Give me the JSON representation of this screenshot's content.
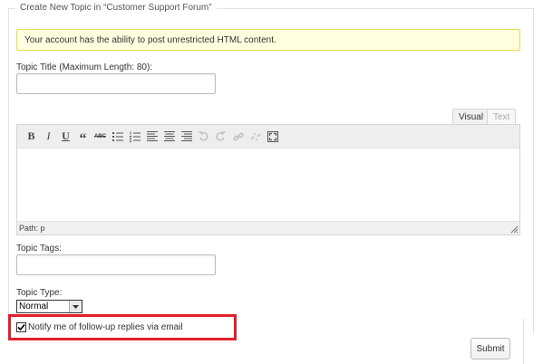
{
  "form": {
    "legend": "Create New Topic in “Customer Support Forum”",
    "notice": "Your account has the ability to post unrestricted HTML content.",
    "title_label": "Topic Title (Maximum Length: 80):",
    "title_value": "",
    "tags_label": "Topic Tags:",
    "tags_value": "",
    "type_label": "Topic Type:",
    "type_selected": "Normal",
    "notify_label": "Notify me of follow-up replies via email",
    "notify_checked": true,
    "submit_label": "Submit"
  },
  "editor": {
    "tabs": [
      "Visual",
      "Text"
    ],
    "active_tab": "Visual",
    "path_label": "Path: p",
    "content": "",
    "toolbar": [
      {
        "name": "bold-icon",
        "glyph": "B"
      },
      {
        "name": "italic-icon",
        "glyph": "I"
      },
      {
        "name": "underline-icon",
        "glyph": "U"
      },
      {
        "name": "blockquote-icon",
        "glyph": "“"
      },
      {
        "name": "strikethrough-icon",
        "glyph": "ABC"
      },
      {
        "name": "bullet-list-icon"
      },
      {
        "name": "numbered-list-icon"
      },
      {
        "name": "align-left-icon"
      },
      {
        "name": "align-center-icon"
      },
      {
        "name": "align-right-icon"
      },
      {
        "name": "undo-icon",
        "disabled": true
      },
      {
        "name": "redo-icon",
        "disabled": true
      },
      {
        "name": "insert-link-icon",
        "disabled": true
      },
      {
        "name": "unlink-icon",
        "disabled": true
      },
      {
        "name": "fullscreen-icon"
      }
    ]
  },
  "colors": {
    "notice_bg": "#ffffe0",
    "notice_border": "#e6db55",
    "highlight_border": "#e3202c"
  }
}
